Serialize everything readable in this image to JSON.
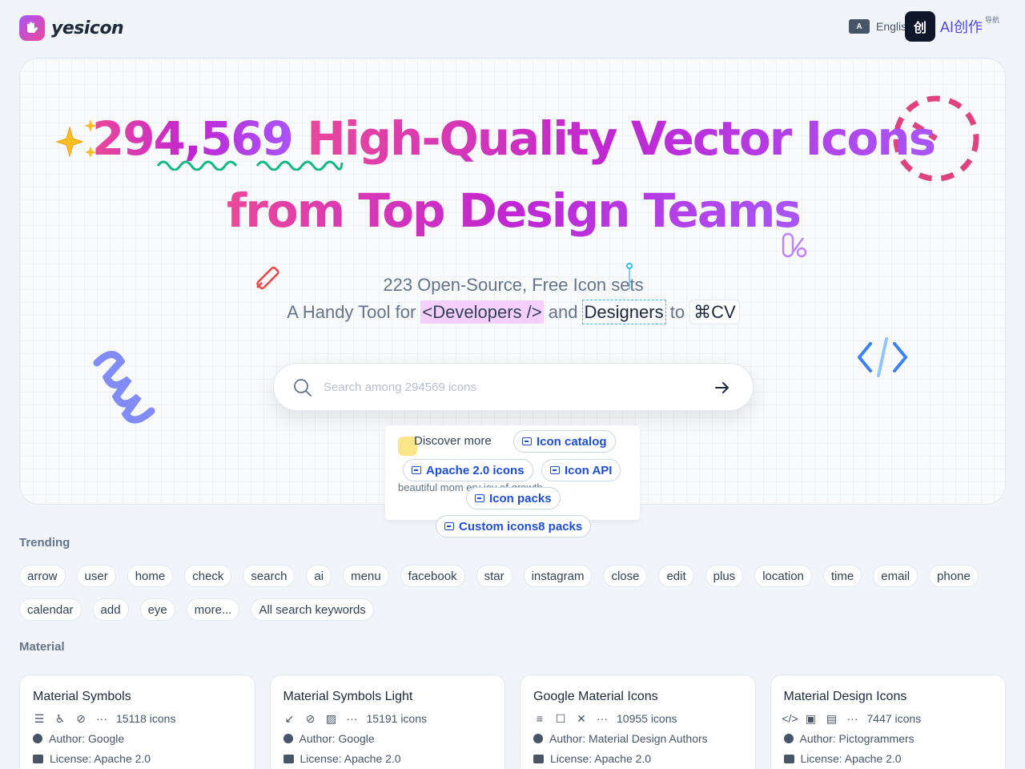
{
  "header": {
    "brand": "yesicon",
    "language": "English",
    "lang_icon": "A",
    "ai_badge": "创",
    "ai_text": "AI创作",
    "ai_sub": "导航"
  },
  "hero": {
    "number": "294,569",
    "headline_rest": " High-Quality Vector Icons",
    "headline_line2": "from Top Design Teams",
    "subtitle1": "223 Open-Source, Free Icon sets",
    "tagline_pre": "A Handy Tool for ",
    "tagline_dev": "<Developers />",
    "tagline_and": " and ",
    "tagline_des": "Designers",
    "tagline_to": " to ",
    "tagline_kbd": "⌘CV",
    "search_placeholder": "Search among 294569 icons"
  },
  "discover": {
    "label": "Discover more",
    "bg_text": "beautiful mom            ery joy of growth.",
    "links": [
      "Icon catalog",
      "Apache 2.0 icons",
      "Icon API",
      "Icon packs",
      "Custom icons8 packs"
    ]
  },
  "trending": {
    "title": "Trending",
    "keywords": [
      "arrow",
      "user",
      "home",
      "check",
      "search",
      "ai",
      "menu",
      "facebook",
      "star",
      "instagram",
      "close",
      "edit",
      "plus",
      "location",
      "time",
      "email",
      "phone",
      "calendar",
      "add",
      "eye",
      "more...",
      "All search keywords"
    ]
  },
  "material": {
    "title": "Material",
    "cards": [
      {
        "name": "Material Symbols",
        "icons": [
          "☰",
          "♿",
          "⊘"
        ],
        "count": "15118 icons",
        "author": "Author: Google",
        "license": "License: Apache 2.0"
      },
      {
        "name": "Material Symbols Light",
        "icons": [
          "↙",
          "⊘",
          "▨"
        ],
        "count": "15191 icons",
        "author": "Author: Google",
        "license": "License: Apache 2.0"
      },
      {
        "name": "Google Material Icons",
        "icons": [
          "≡",
          "☐",
          "✕"
        ],
        "count": "10955 icons",
        "author": "Author: Material Design Authors",
        "license": "License: Apache 2.0"
      },
      {
        "name": "Material Design Icons",
        "icons": [
          "</>",
          "▣",
          "▤"
        ],
        "count": "7447 icons",
        "author": "Author: Pictogrammers",
        "license": "License: Apache 2.0"
      }
    ],
    "more_glyph": "···"
  },
  "colors": {
    "accent_pink": "#ec4899",
    "accent_purple": "#a855f7",
    "link_blue": "#1d4ed8",
    "squiggle_green": "#10b981"
  }
}
